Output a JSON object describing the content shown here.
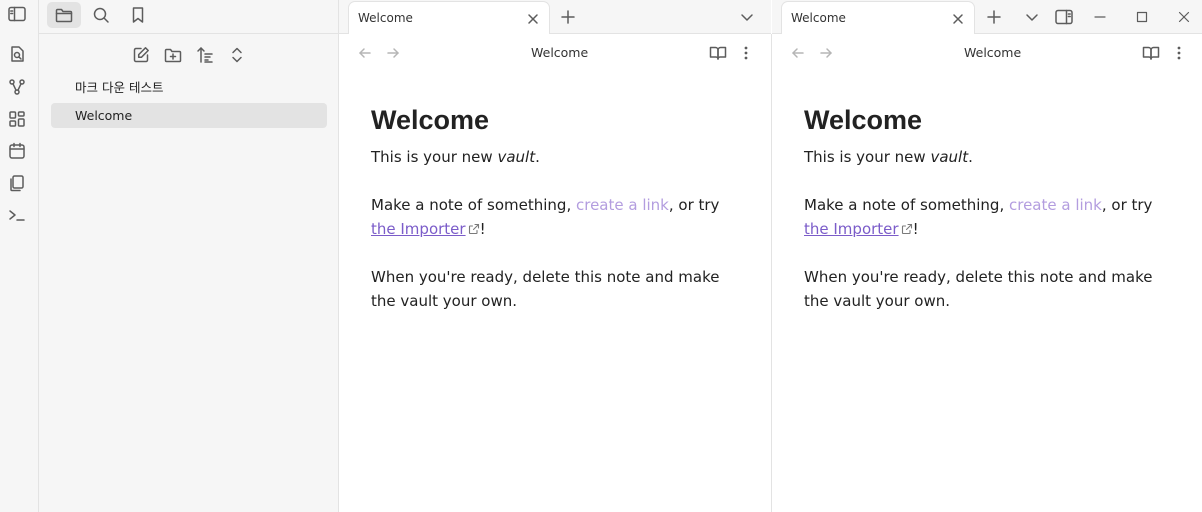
{
  "ribbon": {
    "icons": [
      "sidebar-toggle-icon",
      "open-quick-switcher-icon",
      "graph-view-icon",
      "canvas-icon",
      "daily-notes-icon",
      "templates-icon",
      "command-palette-icon"
    ]
  },
  "sidebar": {
    "tabs": [
      "files-icon",
      "search-icon",
      "bookmarks-icon"
    ],
    "actions": [
      "new-note-icon",
      "new-folder-icon",
      "sort-icon",
      "collapse-icon"
    ],
    "files": [
      {
        "name": "마크 다운 테스트",
        "active": false
      },
      {
        "name": "Welcome",
        "active": true
      }
    ]
  },
  "left_pane": {
    "tab_title": "Welcome",
    "view_title": "Welcome"
  },
  "right_pane": {
    "tab_title": "Welcome",
    "view_title": "Welcome"
  },
  "note": {
    "heading": "Welcome",
    "line1_a": "This is your new ",
    "line1_em": "vault",
    "line1_b": ".",
    "line2_a": "Make a note of something, ",
    "line2_link": "create a link",
    "line2_b": ", or try ",
    "line2_ext": "the Importer",
    "line2_c": "!",
    "line3": "When you're ready, delete this note and make the vault your own."
  },
  "colors": {
    "unresolved_link": "#b39ddf",
    "external_link": "#7b5cc9",
    "chrome_bg": "#f6f6f6",
    "active_bg": "#e3e3e3"
  }
}
